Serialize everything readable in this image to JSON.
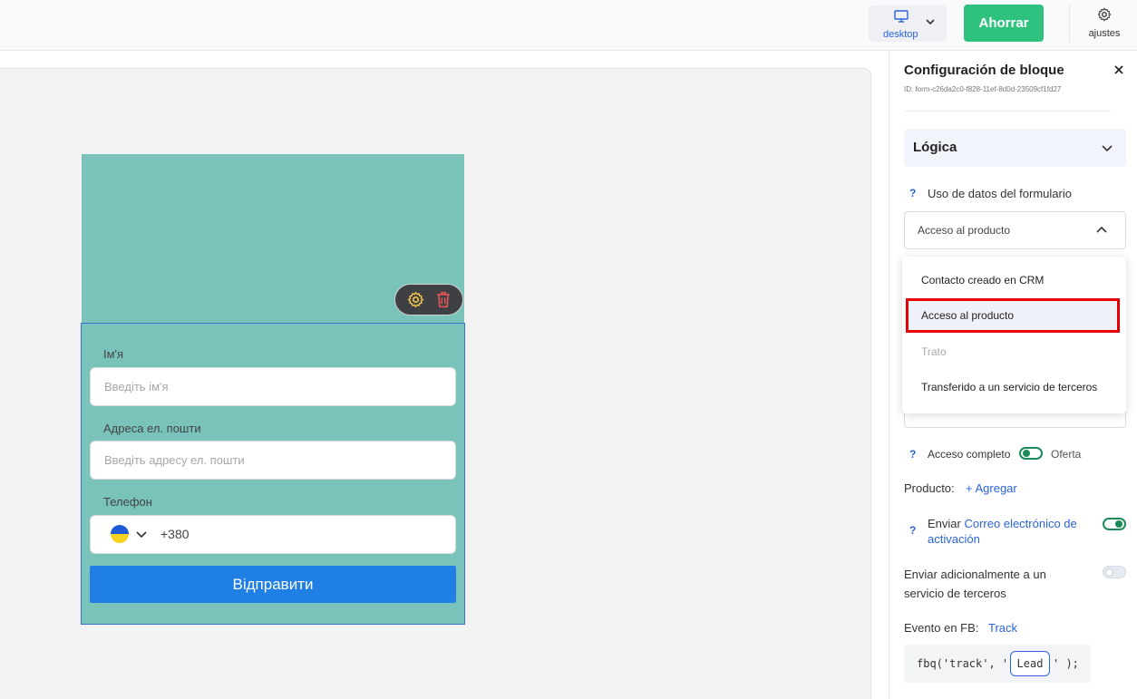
{
  "topbar": {
    "device_label": "desktop",
    "save_label": "Ahorrar",
    "settings_label": "ajustes",
    "colors": {
      "save": "#2ec27e",
      "accent": "#2b63d9"
    }
  },
  "canvas": {
    "form": {
      "name_label": "Ім'я",
      "name_placeholder": "Введіть ім'я",
      "email_label": "Адреса ел. пошти",
      "email_placeholder": "Введіть адресу ел. пошти",
      "phone_label": "Телефон",
      "phone_code": "+380",
      "submit_label": "Відправити"
    },
    "colors": {
      "block_bg": "#79c3bb",
      "submit": "#1f7fe5"
    }
  },
  "panel": {
    "title": "Configuración de bloque",
    "block_id": "ID: form-c26da2c0-f828-11ef-8d0d-23509cf1fd27",
    "section_title": "Lógica",
    "form_data_usage_label": "Uso de datos del formulario",
    "help_mark": "?",
    "selected_option": "Acceso al producto",
    "menu_options": [
      "Contacto creado en CRM",
      "Acceso al producto",
      "Trato",
      "Transferido a un servicio de terceros"
    ],
    "full_access_label": "Acceso completo",
    "offer_label": "Oferta",
    "product_label": "Producto:",
    "add_label": "+ Agregar",
    "send_label": "Enviar",
    "activation_email_link": "Correo electrónico de activación",
    "third_party_label": "Enviar adicionalmente a un servicio de terceros",
    "fb_event_label": "Evento en FB:",
    "fb_event_value": "Track",
    "code_prefix": "fbq('track', '",
    "code_event": "Lead",
    "code_suffix": "' );"
  }
}
